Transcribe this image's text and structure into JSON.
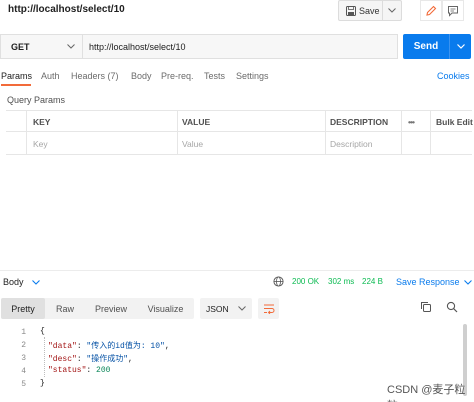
{
  "window": {
    "title": "http://localhost/select/10"
  },
  "toolbar": {
    "save_label": "Save"
  },
  "request": {
    "method": "GET",
    "url": "http://localhost/select/10",
    "send_label": "Send"
  },
  "tabs": [
    {
      "label": "Params"
    },
    {
      "label": "Auth"
    },
    {
      "label": "Headers (7)"
    },
    {
      "label": "Body"
    },
    {
      "label": "Pre-req."
    },
    {
      "label": "Tests"
    },
    {
      "label": "Settings"
    }
  ],
  "cookies_label": "Cookies",
  "query_params": {
    "title": "Query Params",
    "columns": {
      "key": "KEY",
      "value": "VALUE",
      "description": "DESCRIPTION",
      "more": "•••",
      "bulk_edit": "Bulk Edit"
    },
    "placeholders": {
      "key": "Key",
      "value": "Value",
      "description": "Description"
    }
  },
  "response": {
    "body_label": "Body",
    "status": "200 OK",
    "time": "302 ms",
    "size": "224 B",
    "save_response_label": "Save Response",
    "view_tabs": [
      {
        "label": "Pretty"
      },
      {
        "label": "Raw"
      },
      {
        "label": "Preview"
      },
      {
        "label": "Visualize"
      }
    ],
    "format": "JSON",
    "code_lines": [
      {
        "num": "1",
        "text": "{"
      },
      {
        "num": "2",
        "key": "\"data\"",
        "value": "\"传入的id值为: 10\"",
        "tail": ","
      },
      {
        "num": "3",
        "key": "\"desc\"",
        "value": "\"操作成功\"",
        "tail": ","
      },
      {
        "num": "4",
        "key": "\"status\"",
        "value": "200",
        "tail": ""
      },
      {
        "num": "5",
        "text": "}"
      }
    ]
  },
  "watermark": "CSDN @麦子粒粒",
  "colors": {
    "accent": "#097bed",
    "tab_underline": "#f26b3a",
    "success": "#0cbb52"
  }
}
